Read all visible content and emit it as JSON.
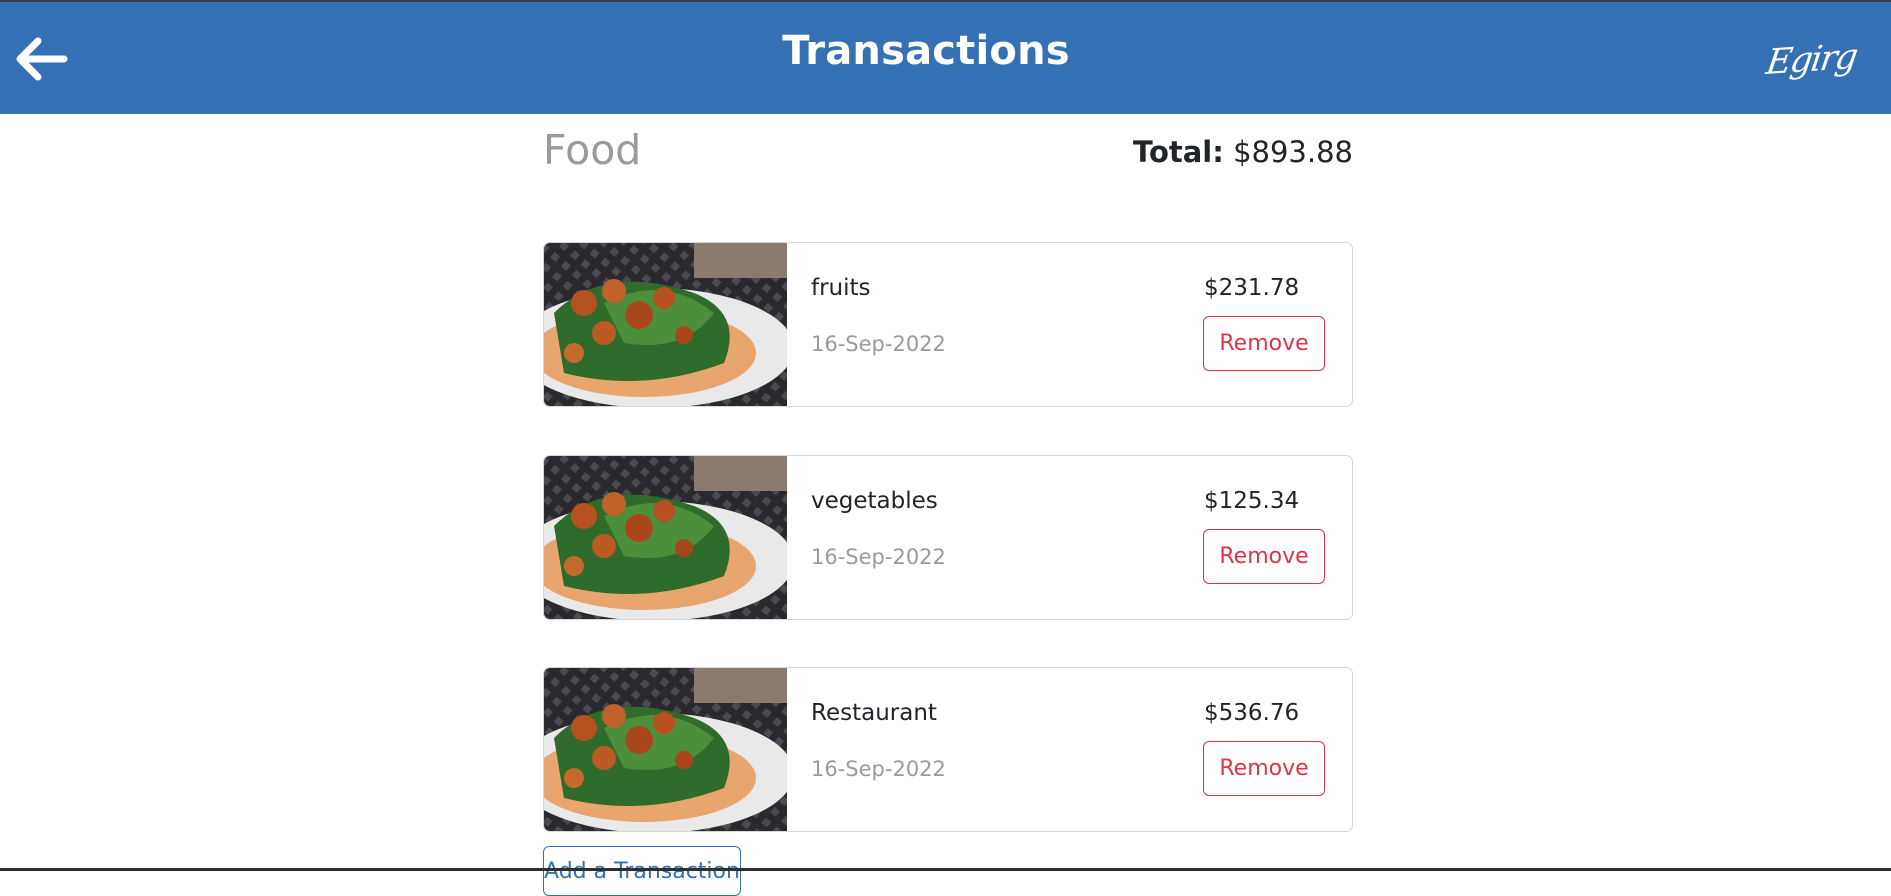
{
  "header": {
    "title": "Transactions",
    "back_icon": "arrow-left-icon",
    "brand": "Egirg",
    "background_color": "#3470b4"
  },
  "category": {
    "name": "Food",
    "total_label": "Total:",
    "total_value": "$893.88"
  },
  "transactions": [
    {
      "name": "fruits",
      "date": "16-Sep-2022",
      "amount": "$231.78",
      "remove_label": "Remove"
    },
    {
      "name": "vegetables",
      "date": "16-Sep-2022",
      "amount": "$125.34",
      "remove_label": "Remove"
    },
    {
      "name": "Restaurant",
      "date": "16-Sep-2022",
      "amount": "$536.76",
      "remove_label": "Remove"
    }
  ],
  "add_button": {
    "label": "Add a Transaction"
  },
  "colors": {
    "primary": "#3470b4",
    "danger": "#dc3545",
    "muted": "#9a9a9a"
  }
}
